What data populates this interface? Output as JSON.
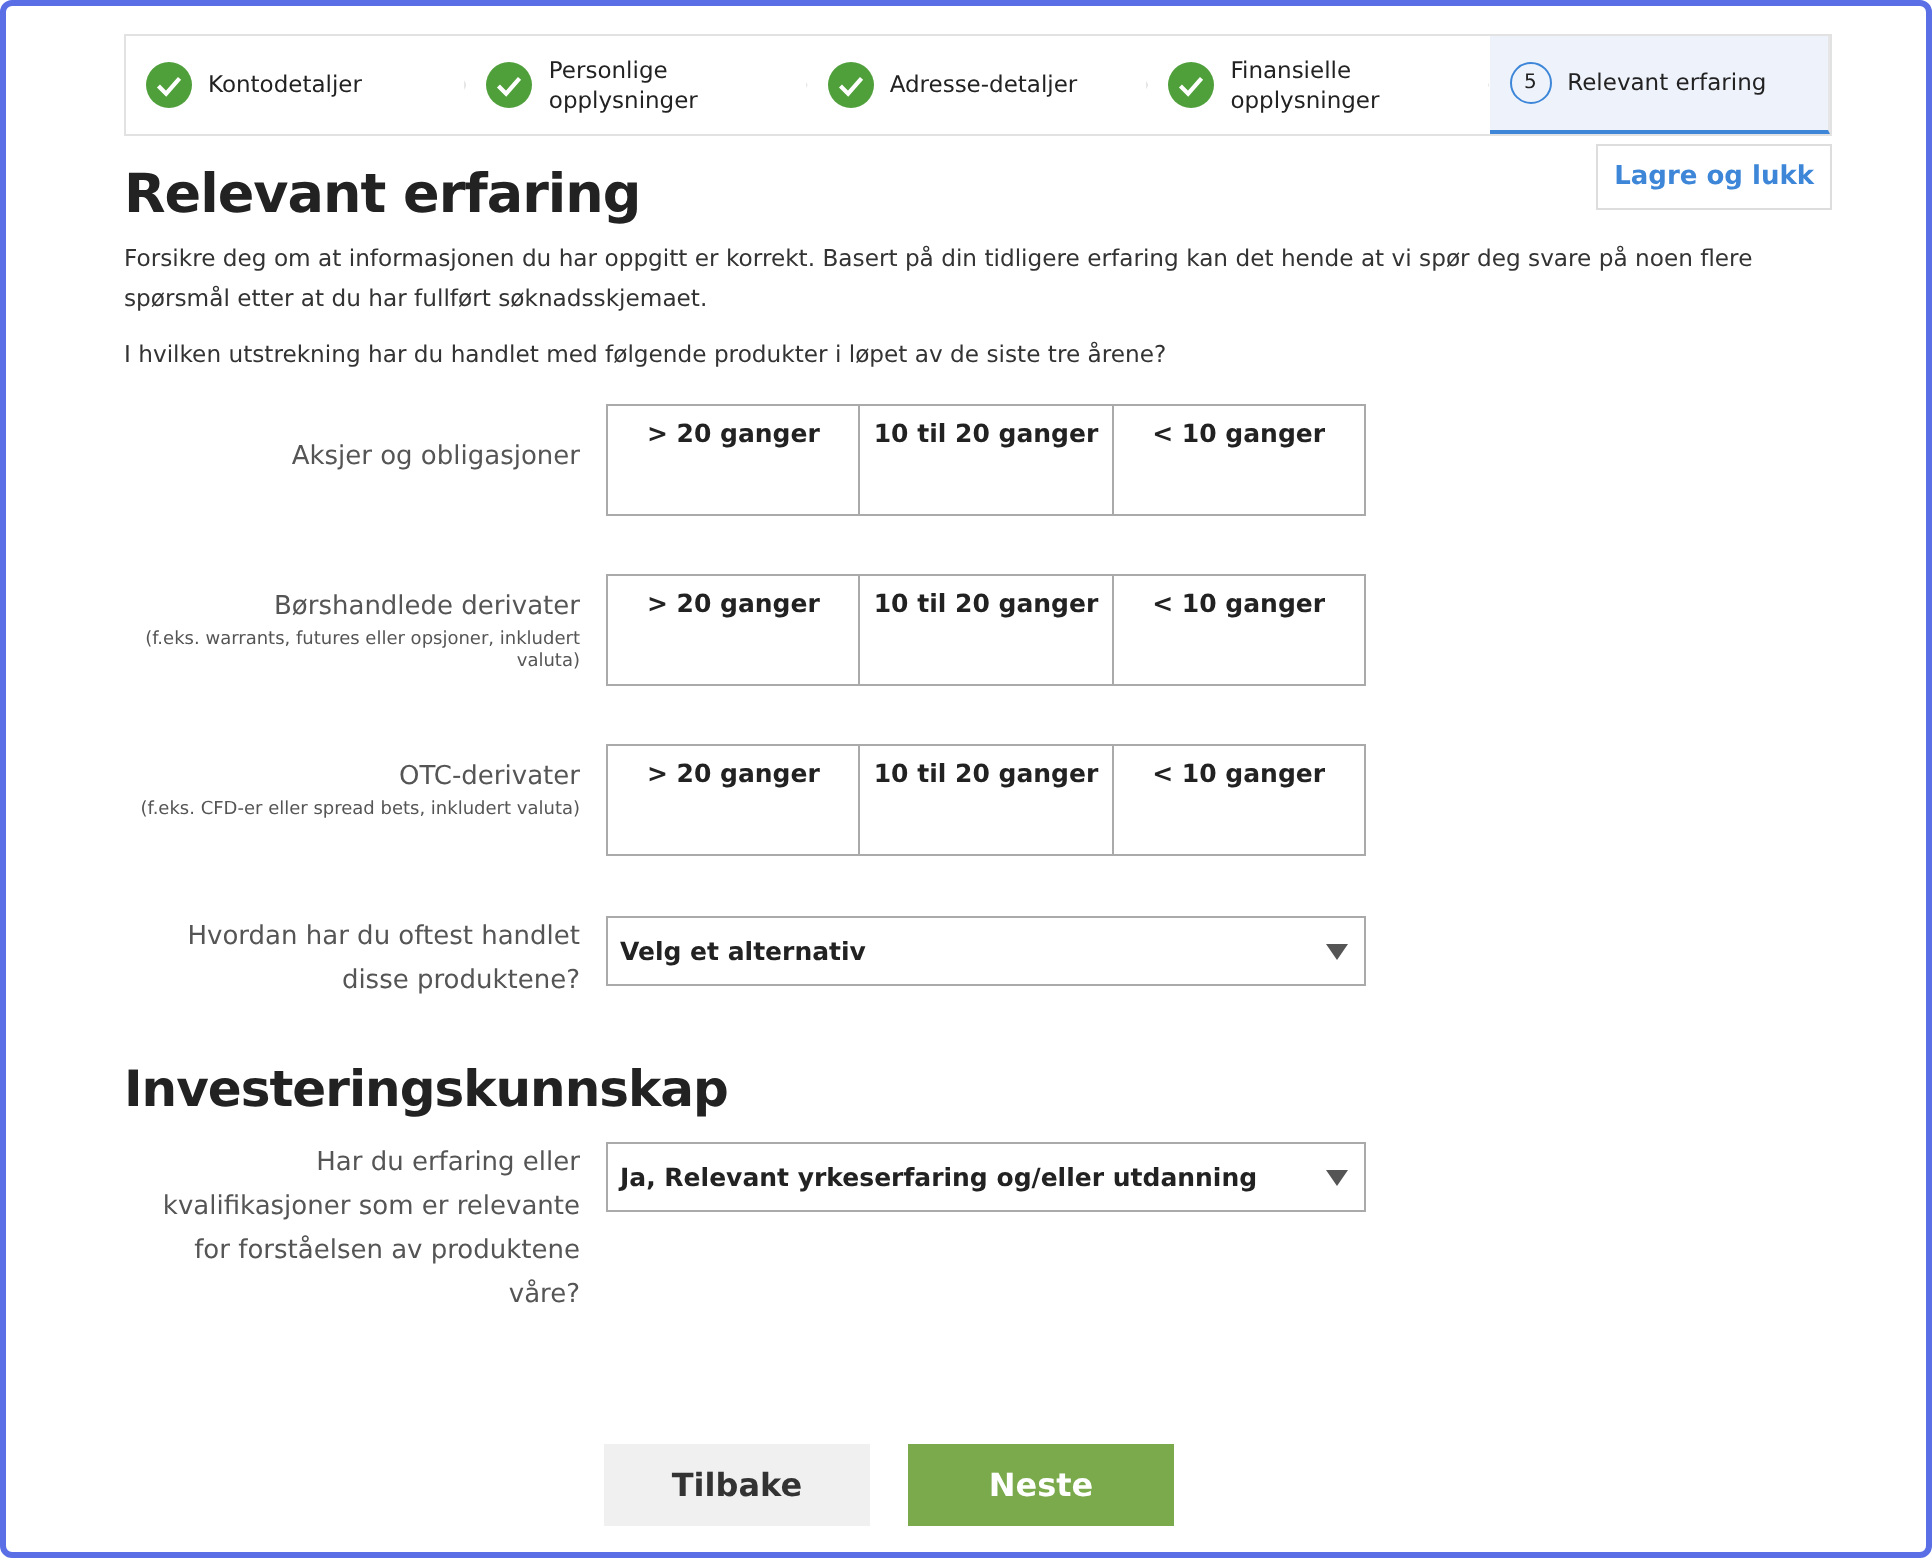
{
  "steps": [
    {
      "label": "Kontodetaljer",
      "completed": true,
      "selected": false
    },
    {
      "label": "Personlige opplysninger",
      "completed": true,
      "selected": false
    },
    {
      "label": "Adresse-detaljer",
      "completed": true,
      "selected": false
    },
    {
      "label": "Finansielle opplysninger",
      "completed": true,
      "selected": false
    },
    {
      "label": "Relevant erfaring",
      "number": "5",
      "completed": false,
      "selected": true
    }
  ],
  "save_button": "Lagre og lukk",
  "title": "Relevant erfaring",
  "intro": "Forsikre deg om at informasjonen du har oppgitt er korrekt. Basert på din tidligere erfaring kan det hende at vi spør deg svare på noen flere spørsmål etter at du har fullført søknadsskjemaet.",
  "question": "I hvilken utstrekning har du handlet med følgende produkter i løpet av de siste tre årene?",
  "products": [
    {
      "label": "Aksjer og obligasjoner",
      "options": [
        {
          "label": "> 20 ganger",
          "selected": false
        },
        {
          "label": "10 til 20 ganger",
          "selected": false
        },
        {
          "label": "< 10 ganger",
          "selected": false
        }
      ]
    },
    {
      "label": "Børshandlede derivater",
      "note": "(f.eks. warrants, futures eller opsjoner, inkludert valuta)",
      "options": [
        {
          "label": "> 20 ganger",
          "selected": false
        },
        {
          "label": "10 til 20 ganger",
          "selected": false
        },
        {
          "label": "< 10 ganger",
          "selected": false
        }
      ]
    },
    {
      "label": "OTC-derivater",
      "note": "(f.eks. CFD-er eller spread bets, inkludert valuta)",
      "options": [
        {
          "label": "> 20 ganger",
          "selected": false
        },
        {
          "label": "10 til 20 ganger",
          "selected": false
        },
        {
          "label": "< 10 ganger",
          "selected": false
        }
      ]
    }
  ],
  "how_traded": {
    "label": "Hvordan har du oftest handlet disse produktene?",
    "value": "Velg et alternativ"
  },
  "knowledge_title": "Investeringskunnskap",
  "knowledge": {
    "label": "Har du erfaring eller kvalifikasjoner som er relevante for forståelsen av produktene våre?",
    "value": "Ja, Relevant yrkeserfaring og/eller utdanning"
  },
  "buttons": [
    {
      "label": "Tilbake",
      "kind": "secondary"
    },
    {
      "label": "Neste",
      "kind": "primary"
    }
  ]
}
